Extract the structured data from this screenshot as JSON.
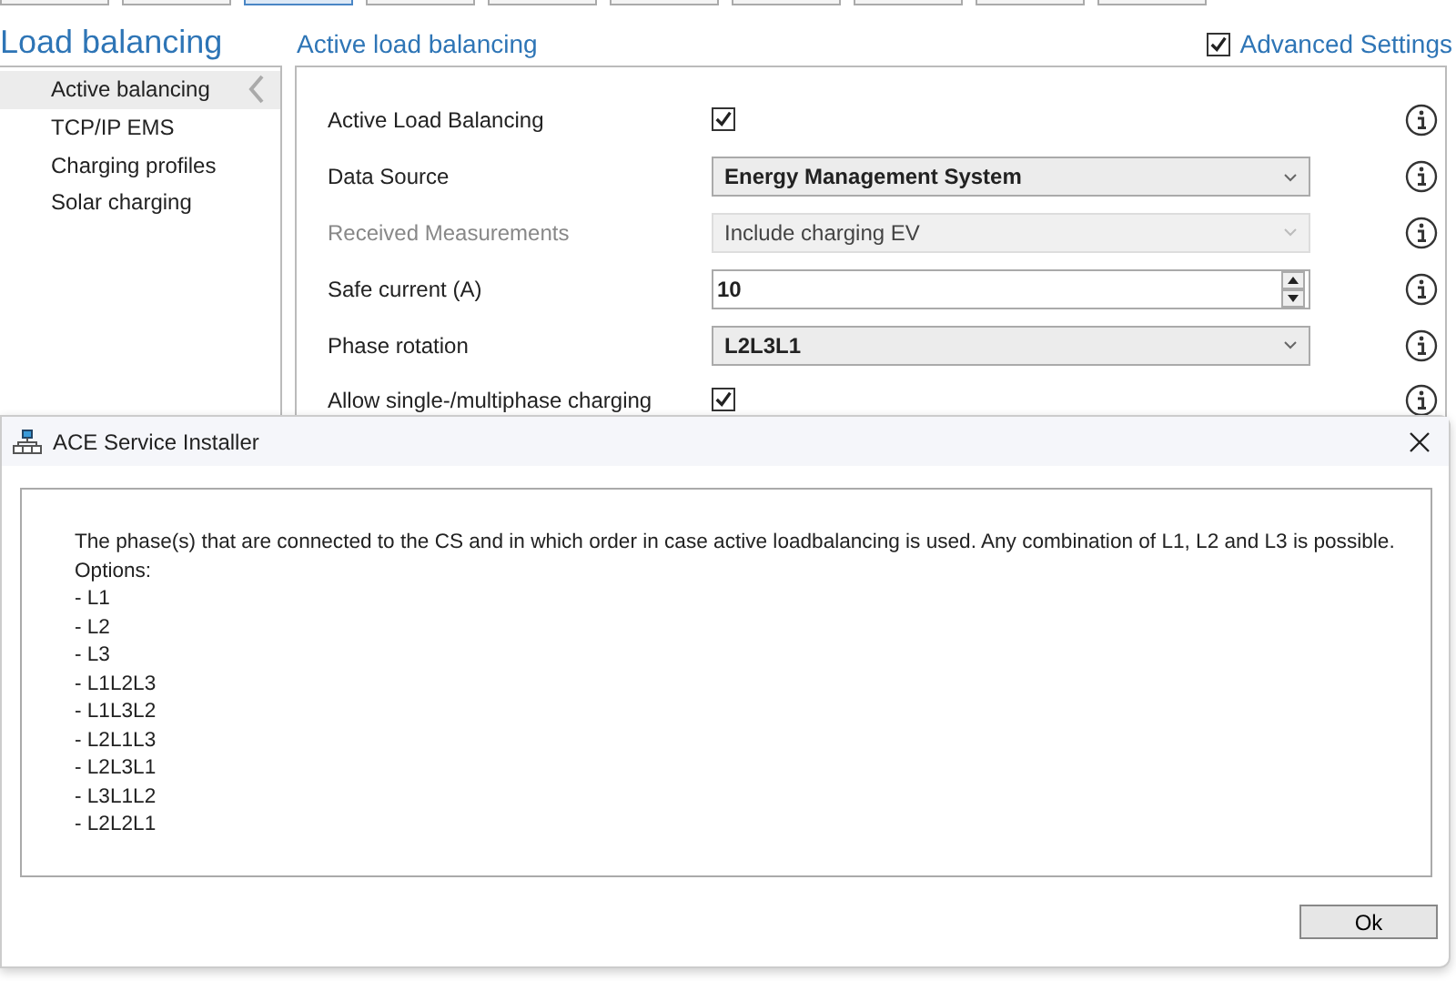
{
  "top_tabs": [
    {
      "selected": false
    },
    {
      "selected": false
    },
    {
      "selected": true
    },
    {
      "selected": false
    },
    {
      "selected": false
    },
    {
      "selected": false
    },
    {
      "selected": false
    },
    {
      "selected": false
    },
    {
      "selected": false
    },
    {
      "selected": false
    }
  ],
  "page_title": "Load balancing",
  "section_title": "Active load balancing",
  "advanced_settings": {
    "label": "Advanced Settings",
    "checked": true
  },
  "sidebar": {
    "items": [
      {
        "label": "Active balancing",
        "selected": true
      },
      {
        "label": "TCP/IP EMS",
        "selected": false
      },
      {
        "label": "Charging profiles",
        "selected": false
      },
      {
        "label": "Solar charging",
        "selected": false
      }
    ]
  },
  "settings": [
    {
      "kind": "checkbox",
      "label": "Active Load Balancing",
      "checked": true,
      "disabled": false
    },
    {
      "kind": "dropdown",
      "label": "Data Source",
      "value": "Energy Management System",
      "disabled": false
    },
    {
      "kind": "dropdown",
      "label": "Received Measurements",
      "value": "Include charging EV",
      "disabled": true
    },
    {
      "kind": "spinner",
      "label": "Safe current (A)",
      "value": "10",
      "disabled": false
    },
    {
      "kind": "dropdown",
      "label": "Phase rotation",
      "value": "L2L3L1",
      "disabled": false
    },
    {
      "kind": "checkbox",
      "label": "Allow single-/multiphase charging",
      "checked": true,
      "disabled": false
    }
  ],
  "dialog": {
    "title": "ACE Service Installer",
    "lines": [
      "The phase(s) that are connected to the CS and in which order in case active loadbalancing is used. Any combination of L1, L2 and L3 is possible.",
      "Options:",
      "- L1",
      "- L2",
      "- L3",
      "- L1L2L3",
      "- L1L3L2",
      "- L2L1L3",
      "- L2L3L1",
      "- L3L1L2",
      "- L2L2L1"
    ],
    "button": "Ok"
  }
}
